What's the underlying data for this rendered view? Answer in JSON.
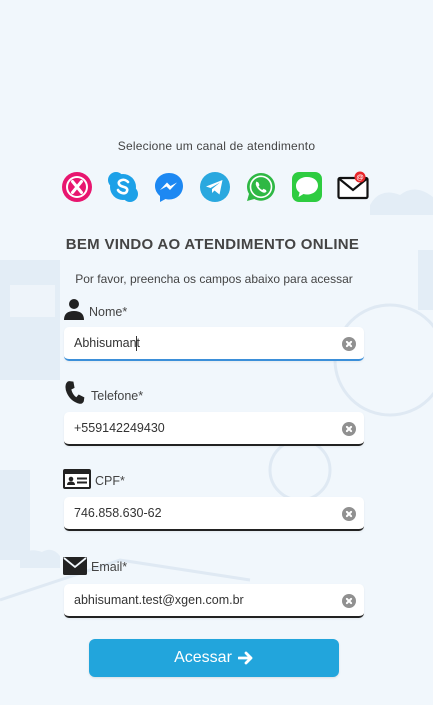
{
  "header": {
    "channel_prompt": "Selecione um canal de atendimento"
  },
  "channels": [
    {
      "name": "xgen",
      "icon": "xgen-icon",
      "color": "#e8166f"
    },
    {
      "name": "skype",
      "icon": "skype-icon",
      "color": "#1da1e8"
    },
    {
      "name": "messenger",
      "icon": "messenger-icon",
      "color": "#1d88f2"
    },
    {
      "name": "telegram",
      "icon": "telegram-icon",
      "color": "#2aa8df"
    },
    {
      "name": "whatsapp",
      "icon": "whatsapp-icon",
      "color": "#2fb844"
    },
    {
      "name": "sms",
      "icon": "message-icon",
      "color": "#2ecc40"
    },
    {
      "name": "email",
      "icon": "email-icon",
      "color": "#111111"
    }
  ],
  "form": {
    "title": "BEM VINDO AO ATENDIMENTO ONLINE",
    "instructions": "Por favor, preencha os campos abaixo para acessar",
    "fields": {
      "nome": {
        "label": "Nome*",
        "value": "Abhisumant",
        "icon": "user-icon"
      },
      "telefone": {
        "label": "Telefone*",
        "value": "+559142249430",
        "icon": "phone-icon"
      },
      "cpf": {
        "label": "CPF*",
        "value": "746.858.630-62",
        "icon": "id-card-icon"
      },
      "email": {
        "label": "Email*",
        "value": "abhisumant.test@xgen.com.br",
        "icon": "envelope-icon"
      }
    },
    "submit_label": "Acessar"
  },
  "colors": {
    "background": "#f1f7fc",
    "button": "#22a5dc",
    "focus_underline": "#3b8fd9"
  }
}
